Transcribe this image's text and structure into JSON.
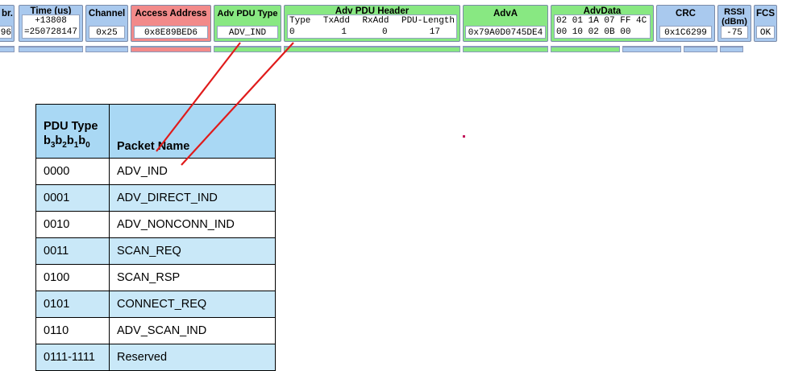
{
  "packet_fields": [
    {
      "id": "abbr",
      "label": "br.",
      "value": "96",
      "color": "blue"
    },
    {
      "id": "time",
      "label": "Time (us)",
      "values": [
        "+13808",
        "=250728147"
      ],
      "color": "blue"
    },
    {
      "id": "channel",
      "label": "Channel",
      "value": "0x25",
      "color": "blue"
    },
    {
      "id": "access",
      "label": "Access Address",
      "value": "0x8E89BED6",
      "color": "red"
    },
    {
      "id": "pdutype",
      "label": "Adv PDU Type",
      "value": "ADV_IND",
      "color": "green"
    },
    {
      "id": "header",
      "label": "Adv PDU Header",
      "sublabels": [
        "Type",
        "TxAdd",
        "RxAdd",
        "PDU-Length"
      ],
      "subvalues": [
        "0",
        "1",
        "0",
        "17"
      ],
      "color": "green"
    },
    {
      "id": "adva",
      "label": "AdvA",
      "value": "0x79A0D0745DE4",
      "color": "green"
    },
    {
      "id": "advdata",
      "label": "AdvData",
      "lines": [
        "02 01 1A 07 FF 4C",
        "00 10 02 0B 00"
      ],
      "color": "green"
    },
    {
      "id": "crc",
      "label": "CRC",
      "value": "0x1C6299",
      "color": "blue"
    },
    {
      "id": "rssi",
      "label": "RSSI (dBm)",
      "label_lines": [
        "RSSI",
        "(dBm)"
      ],
      "value": "-75",
      "color": "blue"
    },
    {
      "id": "fcs",
      "label": "FCS",
      "value": "OK",
      "color": "blue"
    }
  ],
  "pdu_table": {
    "header_type": "PDU Type",
    "header_bits": [
      "b",
      "3",
      "b",
      "2",
      "b",
      "1",
      "b",
      "0"
    ],
    "header_name": "Packet Name",
    "rows": [
      {
        "type": "0000",
        "name": "ADV_IND"
      },
      {
        "type": "0001",
        "name": "ADV_DIRECT_IND"
      },
      {
        "type": "0010",
        "name": "ADV_NONCONN_IND"
      },
      {
        "type": "0011",
        "name": "SCAN_REQ"
      },
      {
        "type": "0100",
        "name": "SCAN_RSP"
      },
      {
        "type": "0101",
        "name": "CONNECT_REQ"
      },
      {
        "type": "0110",
        "name": "ADV_SCAN_IND"
      },
      {
        "type": "0111-1111",
        "name": "Reserved"
      }
    ]
  },
  "colors": {
    "blue": "#a9c9ee",
    "red": "#f28a8a",
    "green": "#88e882",
    "arrow": "#e01b1b",
    "table_header": "#a9d8f4",
    "table_alt": "#c9e8f8"
  }
}
